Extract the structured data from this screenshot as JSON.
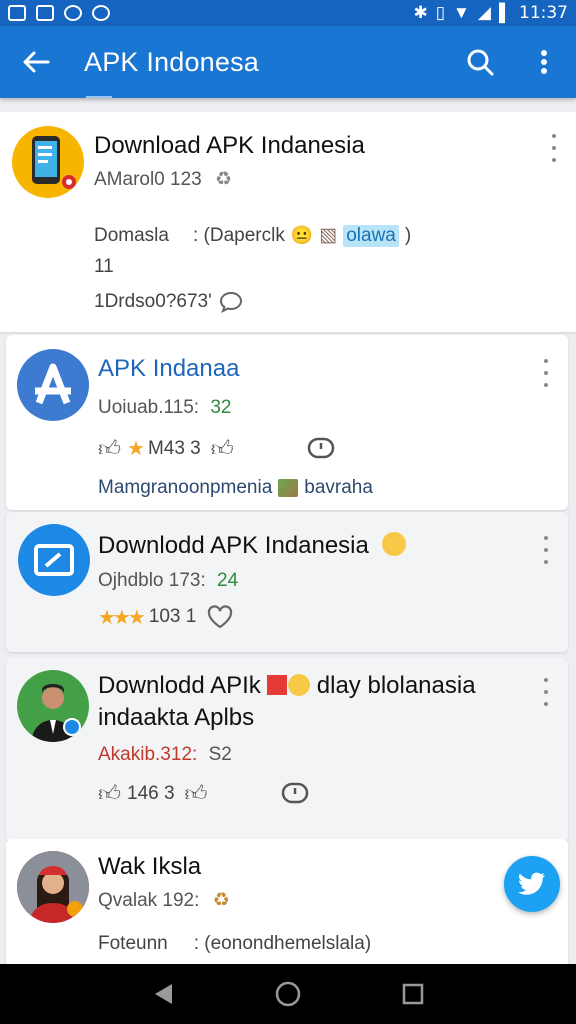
{
  "status_bar": {
    "time": "11:37"
  },
  "app_bar": {
    "title": "APK Indonesa"
  },
  "items": [
    {
      "title": "Download APK Indanesia",
      "subtitle": "AMarol0 123",
      "line3_a": "Domasla",
      "line3_b": ": (Daperclk",
      "line3_link": "olawa",
      "line3_end": ")",
      "line4": "11",
      "line5": "1Drdso0?673'"
    },
    {
      "title": "APK Indanaa",
      "subtitle": "Uoiuab.115:",
      "subtitle_num": "32",
      "stats": "M43 3",
      "line4": "Mamgranoonpmenia",
      "line4_end": "bavraha"
    },
    {
      "title": "Downlodd APK Indanesia",
      "subtitle": "Ojhdblo 173:",
      "subtitle_num": "24",
      "stats": "103 1"
    },
    {
      "title": "Downlodd APIk",
      "title_end": "dlay blolanasia",
      "title_line2": "indaakta Aplbs",
      "subtitle": "Akakib.312:",
      "subtitle_num": "S2",
      "stats": "146 3"
    },
    {
      "title": "Wak Iksla",
      "subtitle": "Qvalak 192:",
      "line3_a": "Foteunn",
      "line3_b": ": (eonondhemelslala)"
    }
  ],
  "icons": {
    "back": "arrow-left-icon",
    "search": "search-icon",
    "overflow": "more-vert-icon",
    "fab": "twitter-bird-icon"
  },
  "colors": {
    "app_bar": "#1976d2",
    "status_bar": "#1565c0",
    "fab": "#1da1f2",
    "accent_blue": "#1e66b8",
    "green": "#2e8b3e"
  }
}
